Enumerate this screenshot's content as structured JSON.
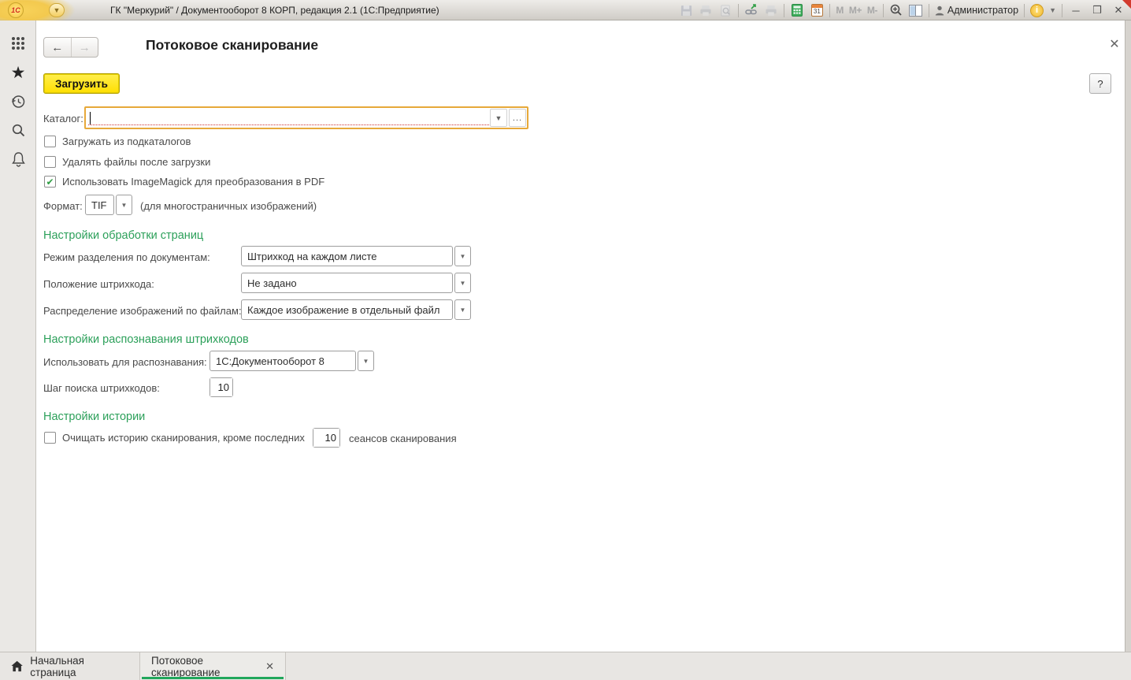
{
  "titlebar": {
    "logo": "1С",
    "title": "ГК \"Меркурий\" / Документооборот 8 КОРП, редакция 2.1  (1С:Предприятие)",
    "memory": {
      "m": "M",
      "m_plus": "M+",
      "m_minus": "M-"
    },
    "calendar_day": "31",
    "user": "Администратор",
    "info_glyph": "i",
    "minimize_glyph": "─",
    "maximize_glyph": "❒",
    "close_glyph": "✕"
  },
  "page": {
    "title": "Потоковое сканирование",
    "close_glyph": "✕",
    "load_button": "Загрузить",
    "help_button": "?"
  },
  "form": {
    "catalog": {
      "label": "Каталог:",
      "value": "",
      "ellipsis_button": "...",
      "dropdown_glyph": "▼"
    },
    "checkboxes": [
      {
        "label": "Загружать из подкаталогов",
        "checked": false,
        "glyph": ""
      },
      {
        "label": "Удалять файлы после загрузки",
        "checked": false,
        "glyph": ""
      },
      {
        "label": "Использовать ImageMagick для преобразования в PDF",
        "checked": true,
        "glyph": "✔"
      }
    ],
    "format": {
      "label": "Формат:",
      "value": "TIF",
      "note": "(для многостраничных изображений)"
    },
    "processing": {
      "header": "Настройки обработки страниц",
      "rows": [
        {
          "label": "Режим разделения по документам:",
          "value": "Штрихкод на каждом листе"
        },
        {
          "label": "Положение штрихкода:",
          "value": "Не задано"
        },
        {
          "label": "Распределение изображений по файлам:",
          "value": "Каждое изображение в отдельный файл"
        }
      ]
    },
    "recognition": {
      "header": "Настройки распознавания штрихкодов",
      "use_label": "Использовать для распознавания:",
      "use_value": "1С:Документооборот 8",
      "step_label": "Шаг поиска штрихкодов:",
      "step_value": "10"
    },
    "history": {
      "header": "Настройки истории",
      "clear_label": "Очищать историю сканирования, кроме последних",
      "clear_value": "10",
      "clear_suffix": "сеансов сканирования",
      "checked": false,
      "glyph": ""
    }
  },
  "tabbar": {
    "home_tab": "Начальная страница",
    "active_tab": "Потоковое сканирование",
    "close_glyph": "✕"
  },
  "colors": {
    "accent_green": "#2ca05a",
    "tab_underline": "#21a75c",
    "button_yellow": "#ffdf00",
    "focus_orange": "#e7a93a",
    "required_red": "#cc3333"
  }
}
